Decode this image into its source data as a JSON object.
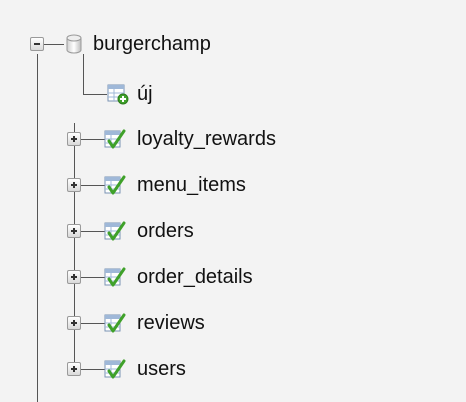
{
  "database": {
    "name": "burgerchamp",
    "icon": "database-icon",
    "expanded": true
  },
  "new_item": {
    "label": "új",
    "icon": "new-table-icon"
  },
  "tables": [
    {
      "name": "loyalty_rewards",
      "icon": "table-structure-icon"
    },
    {
      "name": "menu_items",
      "icon": "table-structure-icon"
    },
    {
      "name": "orders",
      "icon": "table-structure-icon"
    },
    {
      "name": "order_details",
      "icon": "table-structure-icon"
    },
    {
      "name": "reviews",
      "icon": "table-structure-icon"
    },
    {
      "name": "users",
      "icon": "table-structure-icon"
    }
  ],
  "colors": {
    "tree_line": "#555555",
    "icon_green": "#3fa12a",
    "icon_blue": "#2d7fc1"
  }
}
